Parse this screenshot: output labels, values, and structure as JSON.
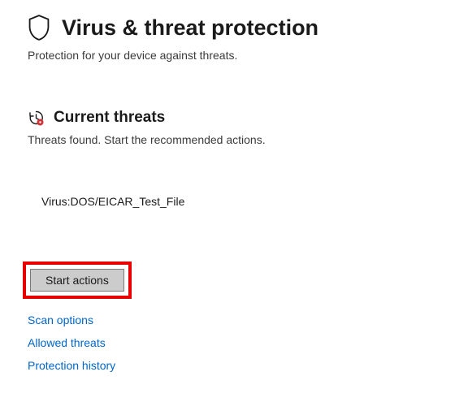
{
  "header": {
    "title": "Virus & threat protection",
    "subtitle": "Protection for your device against threats."
  },
  "icons": {
    "shield": "shield-icon",
    "threat": "threat-history-icon"
  },
  "threats_section": {
    "title": "Current threats",
    "subtitle": "Threats found. Start the recommended actions.",
    "items": [
      "Virus:DOS/EICAR_Test_File"
    ],
    "start_actions_label": "Start actions"
  },
  "links": {
    "scan_options": "Scan options",
    "allowed_threats": "Allowed threats",
    "protection_history": "Protection history"
  }
}
